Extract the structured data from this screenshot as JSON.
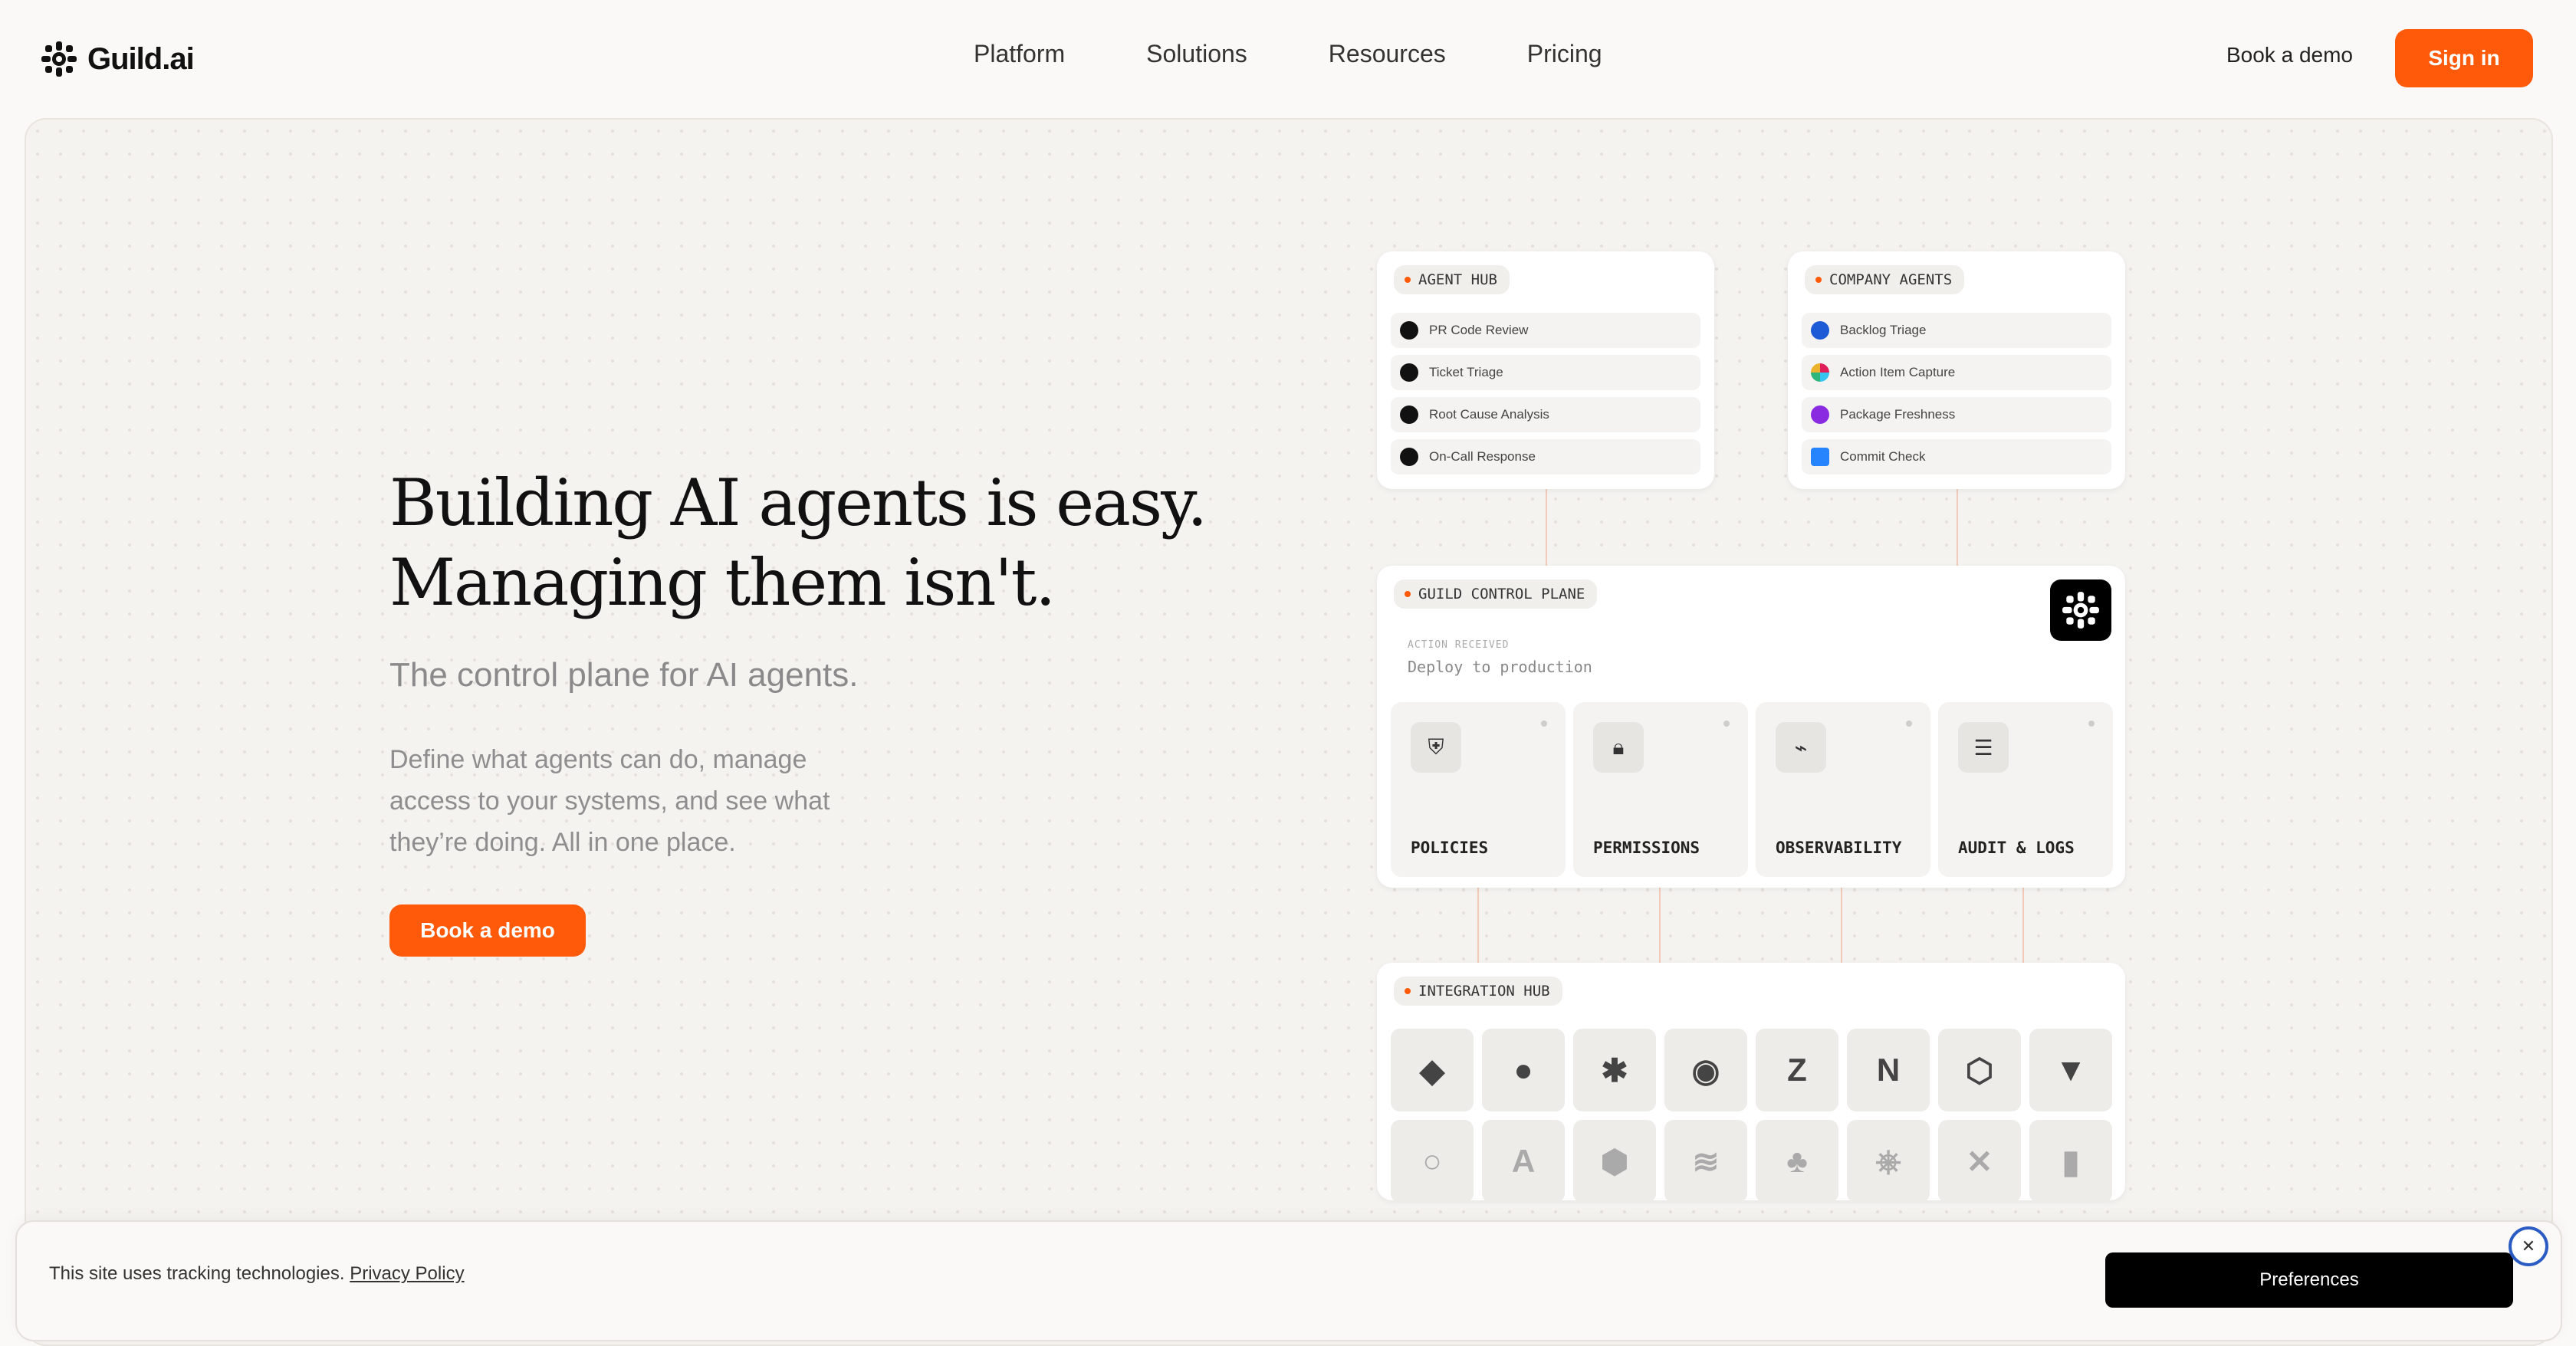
{
  "nav": {
    "logo_text": "Guild.ai",
    "menu": [
      "Platform",
      "Solutions",
      "Resources",
      "Pricing"
    ],
    "book_demo": "Book a demo",
    "sign_in": "Sign in"
  },
  "hero": {
    "headline_line1": "Building AI agents is easy.",
    "headline_line2": "Managing them isn't.",
    "subtitle": "The control plane for AI agents.",
    "description": "Define what agents can do, manage access to your systems, and see what they’re doing. All in one place.",
    "cta": "Book a demo"
  },
  "agent_hub": {
    "title": "AGENT HUB",
    "items": [
      "PR Code Review",
      "Ticket Triage",
      "Root Cause Analysis",
      "On-Call Response"
    ]
  },
  "company_agents": {
    "title": "COMPANY AGENTS",
    "items": [
      "Backlog Triage",
      "Action Item Capture",
      "Package Freshness",
      "Commit Check"
    ]
  },
  "control_plane": {
    "title": "GUILD CONTROL PLANE",
    "action_label": "ACTION RECEIVED",
    "action_value": "Deploy to production",
    "tiles": [
      "POLICIES",
      "PERMISSIONS",
      "OBSERVABILITY",
      "AUDIT & LOGS"
    ]
  },
  "integration_hub": {
    "title": "INTEGRATION HUB",
    "icons": [
      "jira-icon",
      "linear-icon",
      "slack-icon",
      "github-icon",
      "zendesk-icon",
      "notion-icon",
      "azure-devops-icon",
      "bitbucket-icon",
      "cypress-icon",
      "vercel-icon",
      "codepipeline-icon",
      "docker-icon",
      "figma-icon",
      "kubernetes-icon",
      "confluence-icon",
      "doc-icon"
    ]
  },
  "cookie": {
    "text": "This site uses tracking technologies.",
    "link": "Privacy Policy",
    "preferences": "Preferences"
  },
  "colors": {
    "accent": "#ff5a0a",
    "dark": "#000000"
  }
}
